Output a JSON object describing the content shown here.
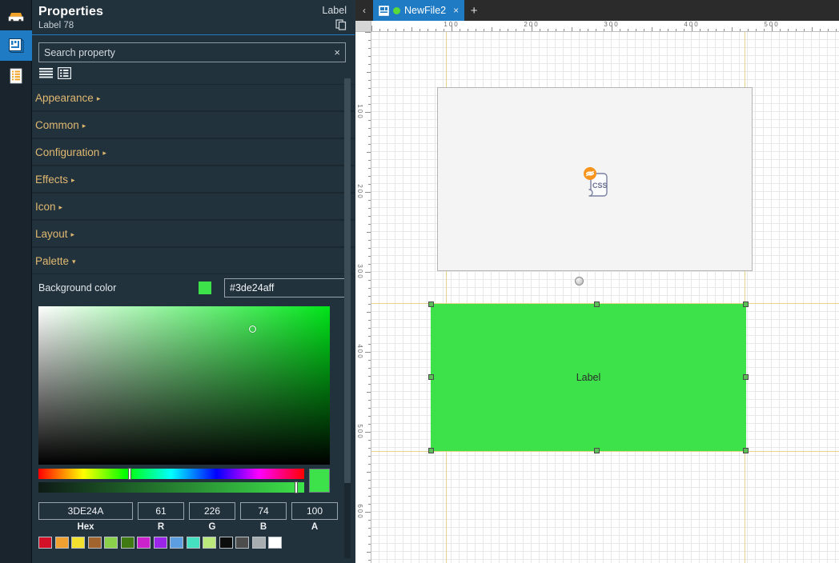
{
  "rail": {
    "items": [
      {
        "name": "library-icon",
        "label": "Library",
        "active": false
      },
      {
        "name": "hierarchy-icon",
        "label": "Hierarchy",
        "active": true
      },
      {
        "name": "properties-list-icon",
        "label": "Properties",
        "active": false
      }
    ]
  },
  "properties": {
    "title": "Properties",
    "subtitle": "Label 78",
    "type_label": "Label",
    "copy_icon": "copy-icon",
    "search": {
      "placeholder": "Search property",
      "value": "",
      "clear_glyph": "×"
    },
    "view_modes": [
      {
        "name": "flat-list-view-icon",
        "label": "Flat list"
      },
      {
        "name": "categorized-view-icon",
        "label": "Categorized"
      }
    ],
    "sections": [
      {
        "label": "Appearance",
        "expanded": false,
        "arrow": "▸"
      },
      {
        "label": "Common",
        "expanded": false,
        "arrow": "▸"
      },
      {
        "label": "Configuration",
        "expanded": false,
        "arrow": "▸"
      },
      {
        "label": "Effects",
        "expanded": false,
        "arrow": "▸"
      },
      {
        "label": "Icon",
        "expanded": false,
        "arrow": "▸"
      },
      {
        "label": "Layout",
        "expanded": false,
        "arrow": "▸"
      },
      {
        "label": "Palette",
        "expanded": true,
        "arrow": "▾"
      }
    ],
    "background_color_row": {
      "label": "Background color",
      "swatch_color": "#3de24a",
      "hex_value": "#3de24aff"
    }
  },
  "color_picker": {
    "hue_color": "#00e519",
    "selected_color": "#3de24a",
    "fields": [
      {
        "caption": "Hex",
        "value": "3DE24A",
        "type": "hex"
      },
      {
        "caption": "R",
        "value": "61",
        "type": "num"
      },
      {
        "caption": "G",
        "value": "226",
        "type": "num"
      },
      {
        "caption": "B",
        "value": "74",
        "type": "num"
      },
      {
        "caption": "A",
        "value": "100",
        "type": "num"
      }
    ],
    "swatches": [
      "#d40f28",
      "#f0a030",
      "#f2e02e",
      "#a2642f",
      "#8ad04a",
      "#3f7a12",
      "#cc22cc",
      "#9b25e8",
      "#5c9ee0",
      "#45e0c0",
      "#bbe87a",
      "#0d0d0d",
      "#4d4d4d",
      "#a8adb0",
      "#ffffff"
    ]
  },
  "design": {
    "tab_back_glyph": "‹",
    "tab_add_glyph": "+",
    "tabs": [
      {
        "label": "NewFile2",
        "icon": "file-designer-icon",
        "modified_dot_color": "#5bd93b",
        "close_glyph": "×",
        "active": true
      }
    ],
    "ruler_h_labels": [
      "100",
      "200",
      "300",
      "400",
      "500"
    ],
    "ruler_v_labels": [
      "100",
      "200",
      "300",
      "400",
      "500",
      "600"
    ],
    "root_panel": {
      "name": "root-panel",
      "background": "#f4f4f4"
    },
    "css_icon": {
      "name": "css-disabled-icon",
      "text": "CSS",
      "badge": "eye-off-icon"
    },
    "label_widget": {
      "text": "Label",
      "background": "#3de24a",
      "selected": true
    }
  }
}
